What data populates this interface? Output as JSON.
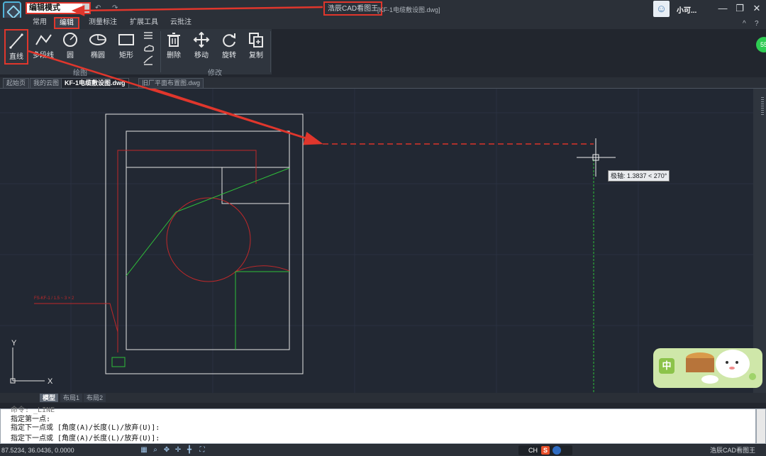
{
  "titlebar": {
    "mode_value": "编辑模式",
    "app_title": "浩辰CAD看图王",
    "file_title": "[KF-1电缆敷设图.dwg]",
    "user_name": "小可...",
    "minimize": "—",
    "restore": "❐",
    "close": "✕"
  },
  "ribbon_tabs": [
    {
      "label": "常用"
    },
    {
      "label": "编辑"
    },
    {
      "label": "测量标注"
    },
    {
      "label": "扩展工具"
    },
    {
      "label": "云批注"
    }
  ],
  "ribbon_right": {
    "collapse": "^",
    "help": "?"
  },
  "draw_group": {
    "label": "绘图",
    "buttons": [
      {
        "label": "直线",
        "icon": "line-icon"
      },
      {
        "label": "多段线",
        "icon": "polyline-icon"
      },
      {
        "label": "圆",
        "icon": "circle-icon"
      },
      {
        "label": "椭圆",
        "icon": "ellipse-icon"
      },
      {
        "label": "矩形",
        "icon": "rectangle-icon"
      }
    ]
  },
  "modify_group": {
    "label": "修改",
    "buttons": [
      {
        "label": "删除",
        "icon": "trash-icon"
      },
      {
        "label": "移动",
        "icon": "move-icon"
      },
      {
        "label": "旋转",
        "icon": "rotate-icon"
      },
      {
        "label": "复制",
        "icon": "copy-icon"
      }
    ]
  },
  "doc_tabs": [
    {
      "label": "起始页"
    },
    {
      "label": "我的云图"
    },
    {
      "label": "KF-1电缆敷设图.dwg"
    },
    {
      "label": "旧厂平面布置图.dwg"
    }
  ],
  "canvas": {
    "tooltip": "极轴: 1.3837 < 270°",
    "red_annotation": "FS-KF-1 / 1.5 ~ 3 × 2",
    "axis_y": "Y",
    "axis_x": "X"
  },
  "model_tabs": [
    {
      "label": "模型"
    },
    {
      "label": "布局1"
    },
    {
      "label": "布局2"
    }
  ],
  "command_lines": [
    "命令: _LINE",
    "指定第一点:",
    "指定下一点或 [角度(A)/长度(L)/放弃(U)]:",
    "指定下一点或 [角度(A)/长度(L)/放弃(U)]:"
  ],
  "statusbar": {
    "coords": "87.5234, 36.0436, 0.0000",
    "app_name": "浩辰CAD看图王",
    "ime_label": "CH",
    "ime_logo": "S"
  },
  "side_badge": "55",
  "mascot_label": "中",
  "colors": {
    "highlight": "#e0362c",
    "canvas": "#222833",
    "cad_white": "#e6e6e6",
    "cad_red": "#c0282a",
    "cad_green": "#2fbf3a"
  }
}
